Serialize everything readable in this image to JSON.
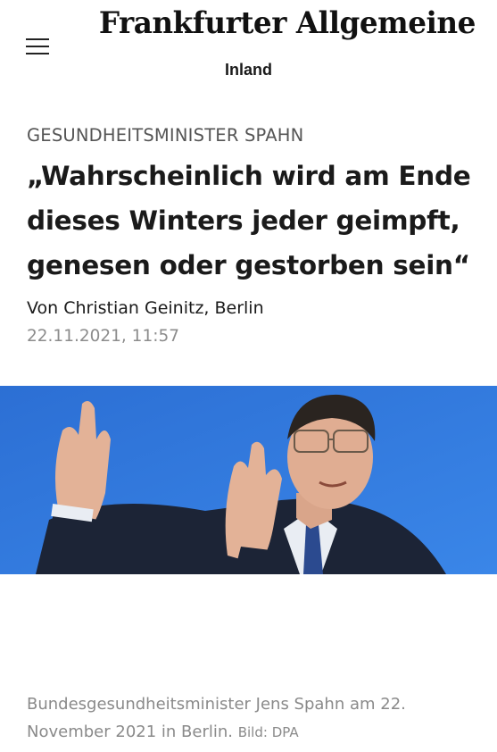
{
  "header": {
    "logo_text": "Frankfurter Allgemeine",
    "section": "Inland"
  },
  "article": {
    "kicker": "GESUNDHEITSMINISTER SPAHN",
    "headline": "„Wahrscheinlich wird am Ende dieses Winters jeder geimpft, genesen oder gestorben sein“",
    "byline": "Von Christian Geinitz, Berlin",
    "timestamp": "22.11.2021, 11:57"
  },
  "image": {
    "caption": "Bundesgesundheitsminister Jens Spahn am 22. November 2021 in Berlin.",
    "credit": "Bild: DPA",
    "background_color": "#2f76d6"
  }
}
